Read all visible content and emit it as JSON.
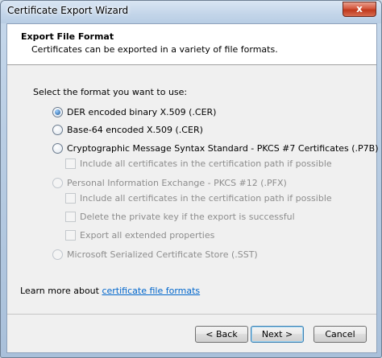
{
  "window": {
    "title": "Certificate Export Wizard",
    "close_glyph": "x"
  },
  "header": {
    "title": "Export File Format",
    "description": "Certificates can be exported in a variety of file formats."
  },
  "prompt": "Select the format you want to use:",
  "options": {
    "der": {
      "label": "DER encoded binary X.509 (.CER)",
      "checked": true,
      "enabled": true
    },
    "base64": {
      "label": "Base-64 encoded X.509 (.CER)",
      "checked": false,
      "enabled": true
    },
    "pkcs7": {
      "label": "Cryptographic Message Syntax Standard - PKCS #7 Certificates (.P7B)",
      "checked": false,
      "enabled": true
    },
    "pkcs7_include": {
      "label": "Include all certificates in the certification path if possible",
      "checked": false,
      "enabled": false
    },
    "pfx": {
      "label": "Personal Information Exchange - PKCS #12 (.PFX)",
      "checked": false,
      "enabled": false
    },
    "pfx_include": {
      "label": "Include all certificates in the certification path if possible",
      "checked": false,
      "enabled": false
    },
    "pfx_delete": {
      "label": "Delete the private key if the export is successful",
      "checked": false,
      "enabled": false
    },
    "pfx_export_props": {
      "label": "Export all extended properties",
      "checked": false,
      "enabled": false
    },
    "sst": {
      "label": "Microsoft Serialized Certificate Store (.SST)",
      "checked": false,
      "enabled": false
    }
  },
  "learn_more": {
    "prefix": "Learn more about ",
    "link": "certificate file formats"
  },
  "buttons": {
    "back": "< Back",
    "next": "Next >",
    "cancel": "Cancel"
  },
  "colors": {
    "link": "#0066cc",
    "disabled_text": "#8d8d8d",
    "client_bg": "#f0f0f0",
    "close_button": "#c0391d"
  }
}
